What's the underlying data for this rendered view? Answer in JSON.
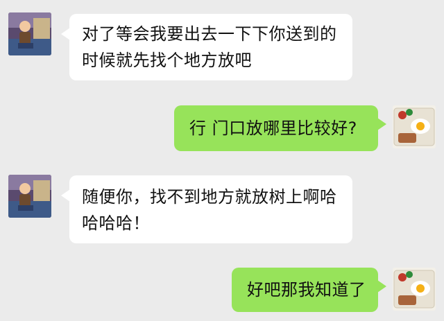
{
  "conversation": {
    "messages": [
      {
        "sender": "contact",
        "avatar": "cartoon-person-avatar",
        "text": "对了等会我要出去一下下你送到的\n时候就先找个地方放吧"
      },
      {
        "sender": "me",
        "avatar": "food-plate-avatar",
        "text": "行 门口放哪里比较好?"
      },
      {
        "sender": "contact",
        "avatar": "cartoon-person-avatar",
        "text": "随便你，找不到地方就放树上啊哈\n哈哈哈！"
      },
      {
        "sender": "me",
        "avatar": "food-plate-avatar",
        "text": "好吧那我知道了"
      }
    ]
  },
  "colors": {
    "background": "#ebebeb",
    "incoming_bubble": "#ffffff",
    "outgoing_bubble": "#97e35a"
  }
}
